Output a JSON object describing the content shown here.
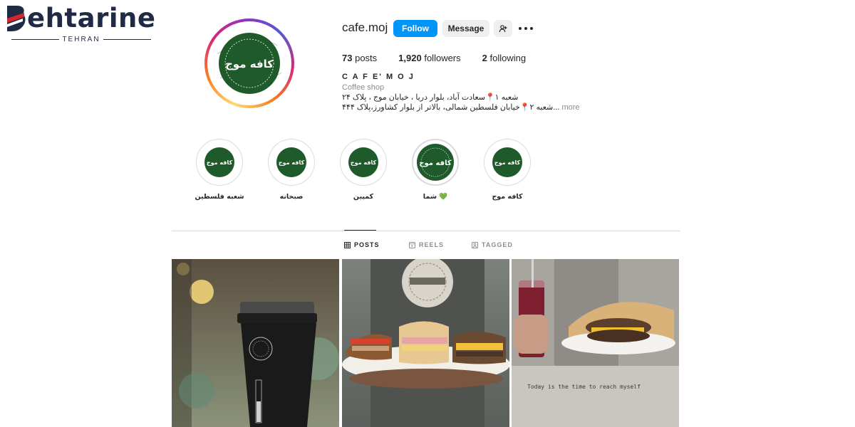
{
  "watermark": {
    "brand": "ehtarine",
    "city": "TEHRAN",
    "brand_color": "#1f2a44",
    "accent_color": "#d6252b"
  },
  "profile": {
    "username": "cafe.moj",
    "avatar_text": "کافه موج",
    "follow_label": "Follow",
    "message_label": "Message",
    "add_user_icon": "add-person-icon",
    "more_icon": "more-options-icon",
    "stats": {
      "posts_count": "73",
      "posts_label": "posts",
      "followers_count": "1,920",
      "followers_label": "followers",
      "following_count": "2",
      "following_label": "following"
    },
    "full_name": "C A F E' M O J",
    "category": "Coffee shop",
    "bio_line1": "شعبه ۱📍سعادت آباد، بلوار دریا ، خیابان موج ، پلاک ۲۴",
    "bio_line2": "شعبه ۲📍خیابان فلسطین شمالی، بالاتر از بلوار کشاورز،پلاک ۴۴۴...",
    "more_label": "more",
    "accent_color": "#0095f6",
    "brand_green": "#1f5a2a"
  },
  "highlights": [
    {
      "label": "شعبه فلسطین"
    },
    {
      "label": "صبحانه"
    },
    {
      "label": "کمپین"
    },
    {
      "label": "شما 💚"
    },
    {
      "label": "کافه موج"
    }
  ],
  "tabs": {
    "posts": "POSTS",
    "reels": "REELS",
    "tagged": "TAGGED"
  },
  "posts": [
    {
      "alt_icon": "coffee-cup-photo"
    },
    {
      "alt_icon": "sandwich-platter-photo"
    },
    {
      "alt_icon": "smoothie-burger-photo",
      "caption": "Today is the time to reach myself"
    }
  ]
}
